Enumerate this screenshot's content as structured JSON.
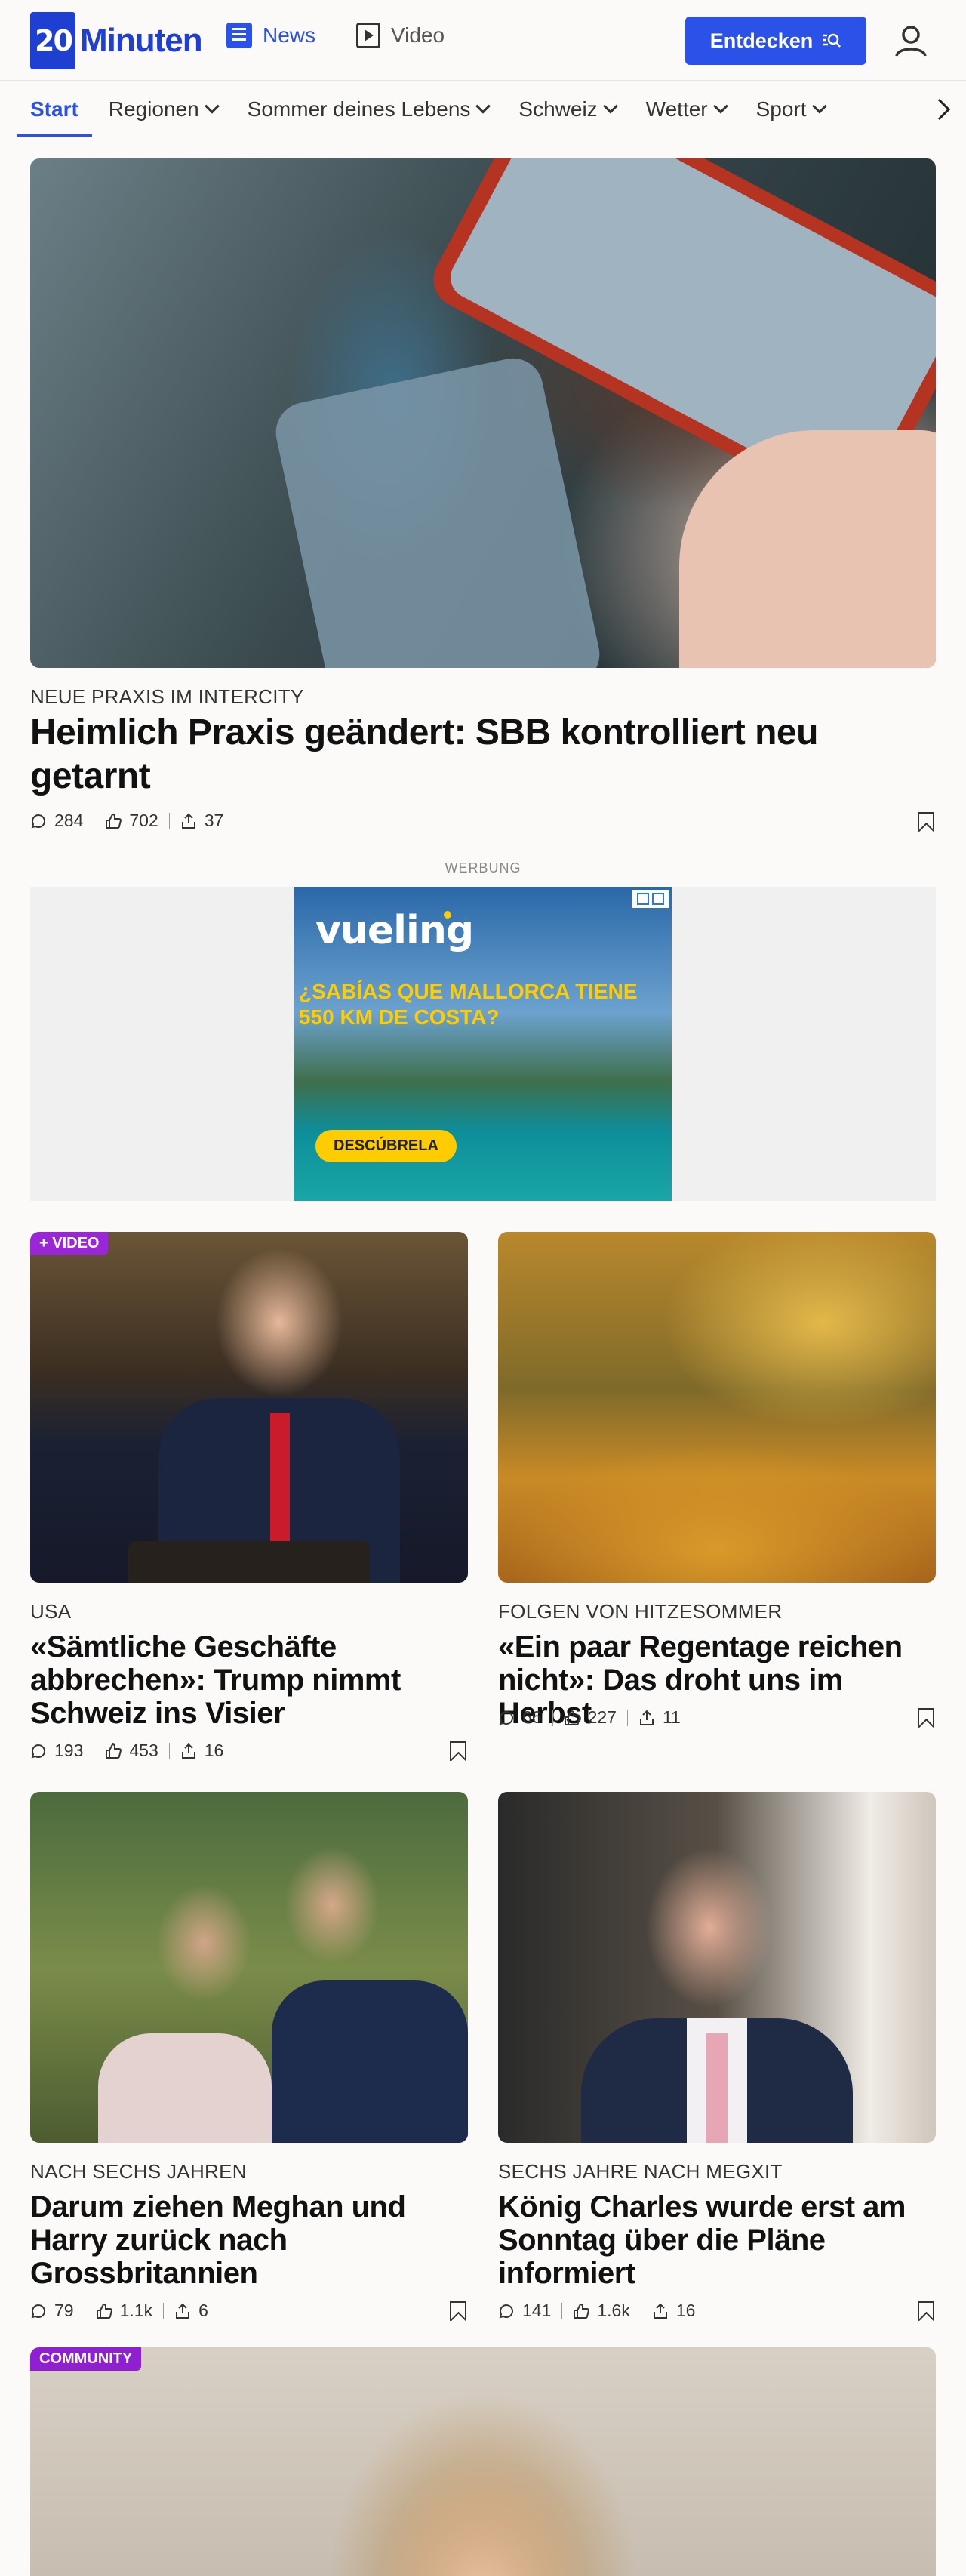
{
  "header": {
    "logo_text": "Minuten",
    "logo_number": "20",
    "nav": [
      {
        "label": "News",
        "icon": "news-icon",
        "active": true
      },
      {
        "label": "Video",
        "icon": "video-icon",
        "active": false
      }
    ],
    "discover_label": "Entdecken",
    "accent_color": "#2a51e8"
  },
  "subnav": {
    "tabs": [
      {
        "label": "Start",
        "active": true
      },
      {
        "label": "Regionen"
      },
      {
        "label": "Sommer deines Lebens"
      },
      {
        "label": "Schweiz"
      },
      {
        "label": "Wetter"
      },
      {
        "label": "Sport"
      }
    ]
  },
  "hero": {
    "kicker": "NEUE PRAXIS IM INTERCITY",
    "title": "Heimlich Praxis geändert: SBB kontrolliert neu getarnt",
    "comments": "284",
    "likes": "702",
    "shares": "37"
  },
  "ad": {
    "label": "WERBUNG",
    "brand": "vueling",
    "headline": "¿SABÍAS QUE MALLORCA TIENE 550 KM DE COSTA?",
    "cta": "DESCÚBRELA"
  },
  "articles": [
    {
      "tag": "+ VIDEO",
      "kicker": "USA",
      "title": "«Sämtliche Geschäfte abbrechen»: Trump nimmt Schweiz ins Visier",
      "comments": "193",
      "likes": "453",
      "shares": "16"
    },
    {
      "kicker": "FOLGEN VON HITZESOMMER",
      "title": "«Ein paar Regentage reichen nicht»: Das droht uns im Herbst",
      "comments": "66",
      "likes": "227",
      "shares": "11"
    },
    {
      "kicker": "NACH SECHS JAHREN",
      "title": "Darum ziehen Meghan und Harry zurück nach Grossbritannien",
      "comments": "79",
      "likes": "1.1k",
      "shares": "6"
    },
    {
      "kicker": "SECHS JAHRE NACH MEGXIT",
      "title": "König Charles wurde erst am Sonntag über die Pläne informiert",
      "comments": "141",
      "likes": "1.6k",
      "shares": "16"
    }
  ],
  "community": {
    "tag": "COMMUNITY"
  }
}
